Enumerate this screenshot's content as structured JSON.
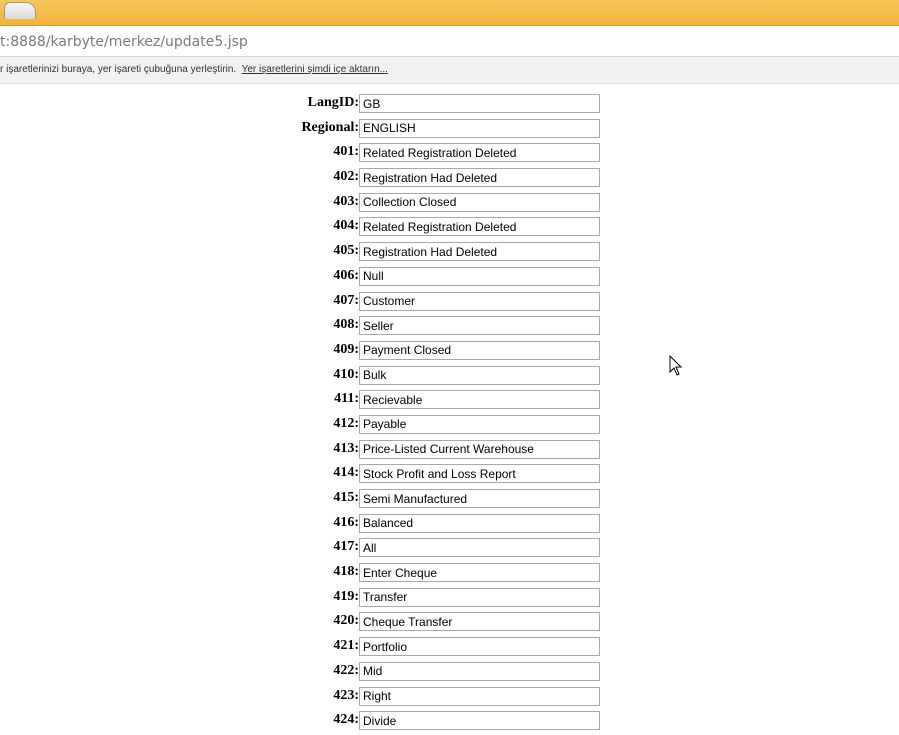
{
  "browser": {
    "url": "t:8888/karbyte/merkez/update5.jsp",
    "bookmarks_hint": "r işaretlerinizi buraya, yer işareti çubuğuna yerleştirin.",
    "bookmarks_import_link": "Yer işaretlerini şimdi içe aktarın..."
  },
  "form": {
    "rows": [
      {
        "label": "LangID:",
        "value": "GB"
      },
      {
        "label": "Regional:",
        "value": "ENGLISH"
      },
      {
        "label": "401:",
        "value": "Related Registration Deleted"
      },
      {
        "label": "402:",
        "value": "Registration Had Deleted"
      },
      {
        "label": "403:",
        "value": "Collection Closed"
      },
      {
        "label": "404:",
        "value": "Related Registration Deleted"
      },
      {
        "label": "405:",
        "value": "Registration Had Deleted"
      },
      {
        "label": "406:",
        "value": "Null"
      },
      {
        "label": "407:",
        "value": "Customer"
      },
      {
        "label": "408:",
        "value": "Seller"
      },
      {
        "label": "409:",
        "value": "Payment Closed"
      },
      {
        "label": "410:",
        "value": "Bulk"
      },
      {
        "label": "411:",
        "value": "Recievable"
      },
      {
        "label": "412:",
        "value": "Payable"
      },
      {
        "label": "413:",
        "value": "Price-Listed Current Warehouse"
      },
      {
        "label": "414:",
        "value": "Stock Profit and Loss Report"
      },
      {
        "label": "415:",
        "value": "Semi Manufactured"
      },
      {
        "label": "416:",
        "value": "Balanced"
      },
      {
        "label": "417:",
        "value": "All"
      },
      {
        "label": "418:",
        "value": "Enter Cheque"
      },
      {
        "label": "419:",
        "value": "Transfer"
      },
      {
        "label": "420:",
        "value": "Cheque Transfer"
      },
      {
        "label": "421:",
        "value": "Portfolio"
      },
      {
        "label": "422:",
        "value": "Mid"
      },
      {
        "label": "423:",
        "value": "Right"
      },
      {
        "label": "424:",
        "value": "Divide"
      }
    ]
  },
  "icons": {
    "tab": "browser-tab",
    "cursor": "mouse-pointer-icon"
  }
}
